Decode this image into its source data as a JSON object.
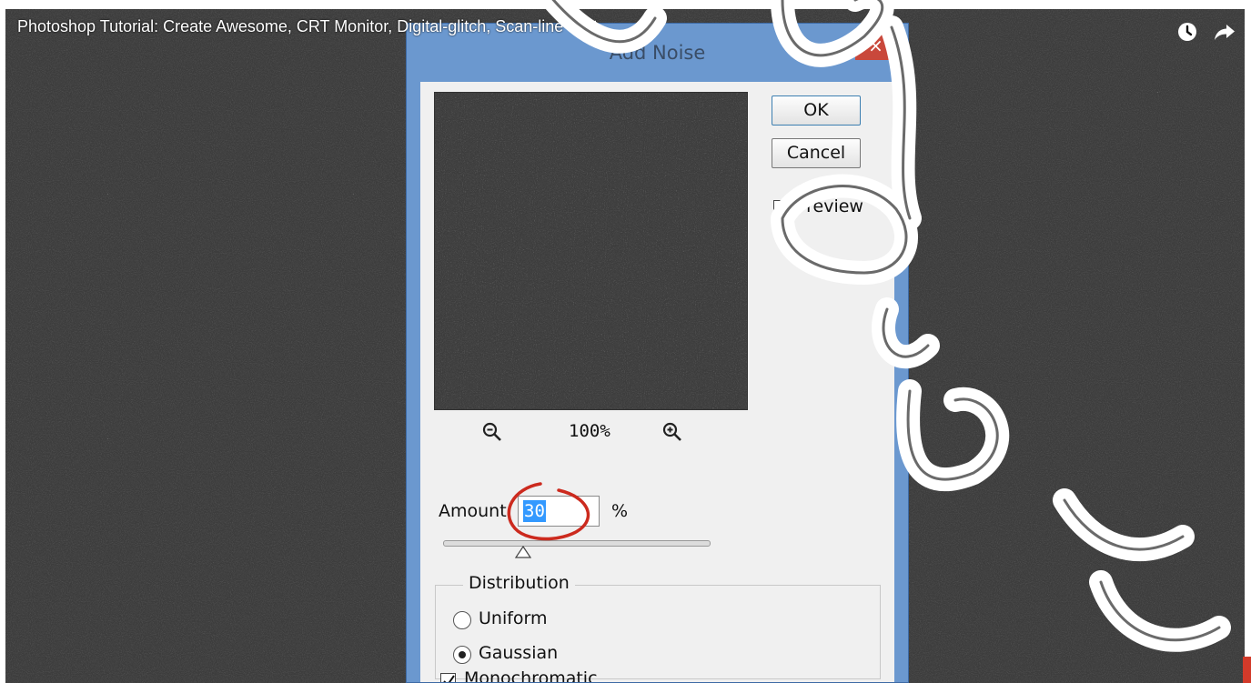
{
  "video": {
    "title": "Photoshop Tutorial: Create Awesome, CRT Monitor, Digital-glitch, Scan-line Text",
    "icons": [
      "watch-later-icon",
      "share-icon"
    ]
  },
  "dialog": {
    "title": "Add Noise",
    "close_label": "×",
    "ok_label": "OK",
    "cancel_label": "Cancel",
    "preview_label": "Preview",
    "preview_checked": true,
    "zoom_level": "100%",
    "amount_label": "Amount:",
    "amount_value": "30",
    "amount_unit": "%",
    "amount_slider_fraction": 0.3,
    "distribution": {
      "legend": "Distribution",
      "options": [
        {
          "label": "Uniform",
          "selected": false
        },
        {
          "label": "Gaussian",
          "selected": true
        }
      ]
    },
    "monochromatic_label": "Monochromatic",
    "monochromatic_checked": true
  },
  "colors": {
    "annotation": "#cc2a1e",
    "selection": "#3399ff",
    "close_button": "#c9483b",
    "dialog_frame": "#6b98cf"
  }
}
